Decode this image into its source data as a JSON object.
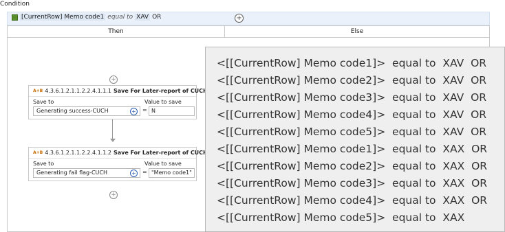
{
  "condition": {
    "section_label": "Condition",
    "field": "[CurrentRow] Memo code1",
    "operator": "equal to",
    "value": "XAV",
    "connector": "OR"
  },
  "branches": {
    "then_label": "Then",
    "else_label": "Else"
  },
  "cards": [
    {
      "icon": "A+B",
      "number": "4.3.6.1.2.1.1.2.2.4.1.1.1",
      "title": "Save For Later-report of CUCH",
      "save_to_label": "Save to",
      "value_label": "Value to save",
      "save_to_value": "Generating success-CUCH",
      "equals": "=",
      "value": "N"
    },
    {
      "icon": "A+B",
      "number": "4.3.6.1.2.1.1.2.2.4.1.1.2",
      "title": "Save For Later-report of CUCH",
      "save_to_label": "Save to",
      "value_label": "Value to save",
      "save_to_value": "Generating fail flag-CUCH",
      "equals": "=",
      "value": "\"Memo code1\""
    }
  ],
  "tooltip": {
    "lines": [
      "<[[CurrentRow] Memo code1]>  equal to  XAV  OR",
      "<[[CurrentRow] Memo code2]>  equal to  XAV  OR",
      "<[[CurrentRow] Memo code3]>  equal to  XAV  OR",
      "<[[CurrentRow] Memo code4]>  equal to  XAV  OR",
      "<[[CurrentRow] Memo code5]>  equal to  XAV  OR",
      "<[[CurrentRow] Memo code1]>  equal to  XAX  OR",
      "<[[CurrentRow] Memo code2]>  equal to  XAX  OR",
      "<[[CurrentRow] Memo code3]>  equal to  XAX  OR",
      "<[[CurrentRow] Memo code4]>  equal to  XAX  OR",
      "<[[CurrentRow] Memo code5]>  equal to  XAX"
    ]
  },
  "icons": {
    "condition": "condition-icon",
    "add": "add-circle-icon",
    "assign": "assign-icon"
  }
}
